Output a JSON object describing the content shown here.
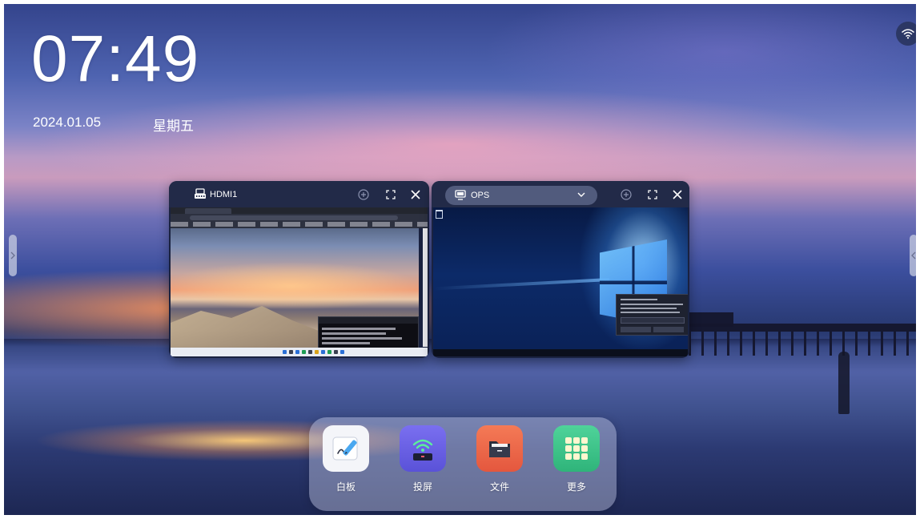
{
  "status": {
    "time": "07:49",
    "date": "2024.01.05",
    "weekday": "星期五"
  },
  "top_right": {
    "icon": "wifi-icon"
  },
  "edge_handles": {
    "left_icon": "chevron-right-icon",
    "right_icon": "chevron-left-icon"
  },
  "windows": [
    {
      "source": "HDMI1",
      "icon": "hdmi-port-icon"
    },
    {
      "source": "OPS",
      "icon": "monitor-icon",
      "dropdown": true
    }
  ],
  "dock": {
    "apps": [
      {
        "label": "白板",
        "icon": "whiteboard-icon"
      },
      {
        "label": "投屏",
        "icon": "screen-cast-icon"
      },
      {
        "label": "文件",
        "icon": "folder-icon"
      },
      {
        "label": "更多",
        "icon": "app-grid-icon"
      }
    ]
  },
  "colors": {
    "window_header": "#222a48",
    "whiteboard_icon_bg": "#f4f5f9",
    "cast_icon_bg": "#6a63e6",
    "folder_icon_bg": "#ee6a4c",
    "grid_icon_bg": "#3ec48a"
  }
}
